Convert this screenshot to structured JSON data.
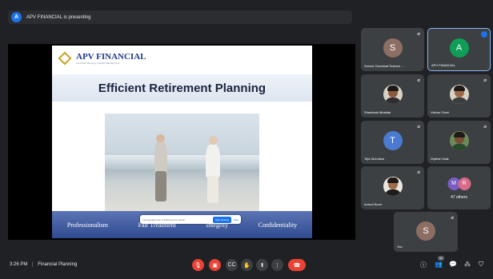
{
  "presenting": {
    "badge": "A",
    "text": "APV FINANCIAL is presenting"
  },
  "slide": {
    "brand": "APV FINANCIAL",
    "tagline": "Financial Planning | Wealth Management",
    "title": "Efficient Retirement Planning",
    "values": [
      "Professionalism",
      "Fair Treatment",
      "Integrity",
      "Confidentiality"
    ],
    "share_bar": {
      "text": "meet.google.com is sharing your screen.",
      "stop": "Stop sharing",
      "hide": "Hide"
    }
  },
  "participants": [
    {
      "name": "School Chemical Science ...",
      "initial": "S",
      "color": "#8d6e63",
      "kind": "letter",
      "muted": true
    },
    {
      "name": "APV FINANCIAL",
      "initial": "A",
      "color": "#0f9d58",
      "kind": "letter",
      "muted": false,
      "active": true
    },
    {
      "name": "Shashank Mhaldar",
      "kind": "photo",
      "muted": true
    },
    {
      "name": "Vishnu Chari",
      "kind": "photo",
      "muted": true
    },
    {
      "name": "Teja Dicholkar",
      "initial": "T",
      "color": "#4a7bd0",
      "kind": "letter",
      "muted": true
    },
    {
      "name": "Diptesh Naik",
      "kind": "photo",
      "muted": true
    },
    {
      "name": "Anmol Noori",
      "kind": "photo",
      "muted": true
    },
    {
      "name": "You",
      "initial": "S",
      "color": "#8d6e63",
      "kind": "letter",
      "muted": true
    }
  ],
  "others": {
    "label": "47 others",
    "initials": [
      "M",
      "R"
    ],
    "colors": [
      "#7b5cc4",
      "#d96b8a"
    ]
  },
  "meeting": {
    "time": "3:26 PM",
    "separator": "|",
    "name": "Financial Planning"
  },
  "controls": {
    "mic_icon": "mic-off-icon",
    "cam_icon": "camera-off-icon",
    "captions_icon": "captions-icon",
    "hand_icon": "raise-hand-icon",
    "present_icon": "present-icon",
    "more_icon": "more-options-icon",
    "end_icon": "end-call-icon",
    "info_icon": "info-icon",
    "people_count": "55",
    "accent": "#ea4335"
  }
}
